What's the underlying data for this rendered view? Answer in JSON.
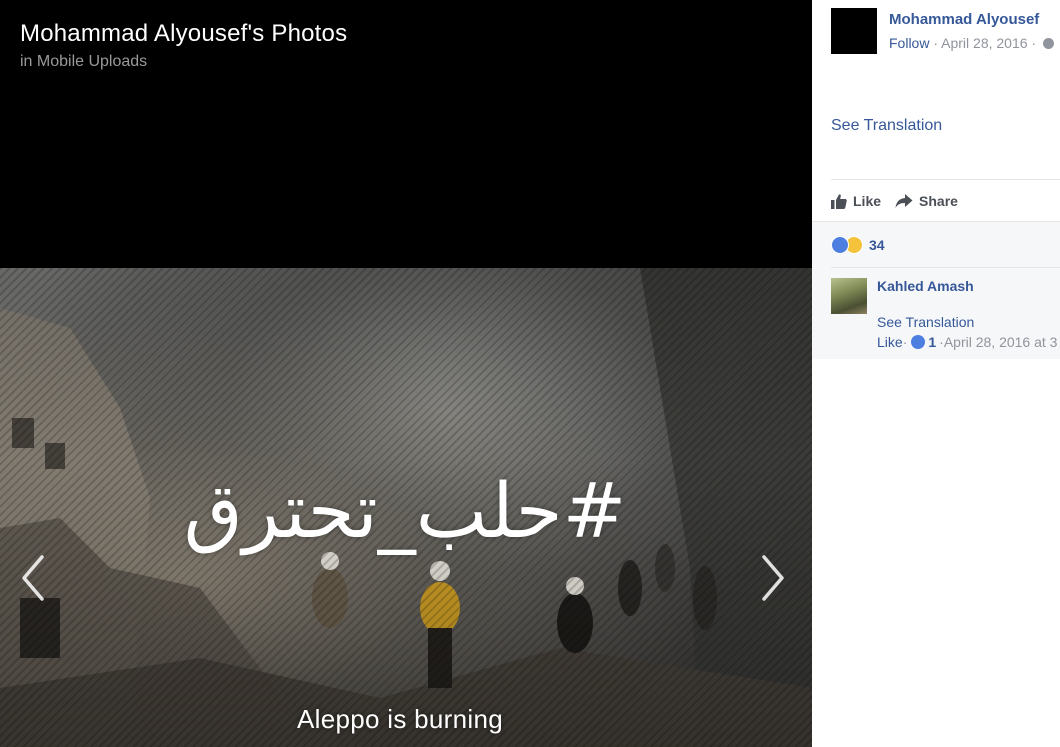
{
  "viewer": {
    "title": "Mohammad Alyousef's Photos",
    "subtitle": "in Mobile Uploads",
    "photo": {
      "hashtag_text": "#حلب_تحترق",
      "caption": "Aleppo is burning"
    },
    "nav": {
      "prev_icon": "chevron-left-icon",
      "next_icon": "chevron-right-icon"
    }
  },
  "post": {
    "author": "Mohammad Alyousef",
    "follow_label": "Follow",
    "separator": " · ",
    "date": "April 28, 2016",
    "audience_icon": "globe-icon",
    "see_translation": "See Translation",
    "actions": {
      "like": "Like",
      "share": "Share"
    },
    "reactions": {
      "count": "34",
      "types": [
        "like-reaction-icon",
        "sad-reaction-icon"
      ]
    }
  },
  "comments": [
    {
      "author": "Kahled Amash",
      "see_translation": "See Translation",
      "like_label": "Like",
      "like_count": "1",
      "timestamp": "April 28, 2016 at 3"
    }
  ],
  "colors": {
    "link": "#365899",
    "meta": "#90949c",
    "viewer_bg": "#000000",
    "comments_bg": "#f6f7f9"
  }
}
